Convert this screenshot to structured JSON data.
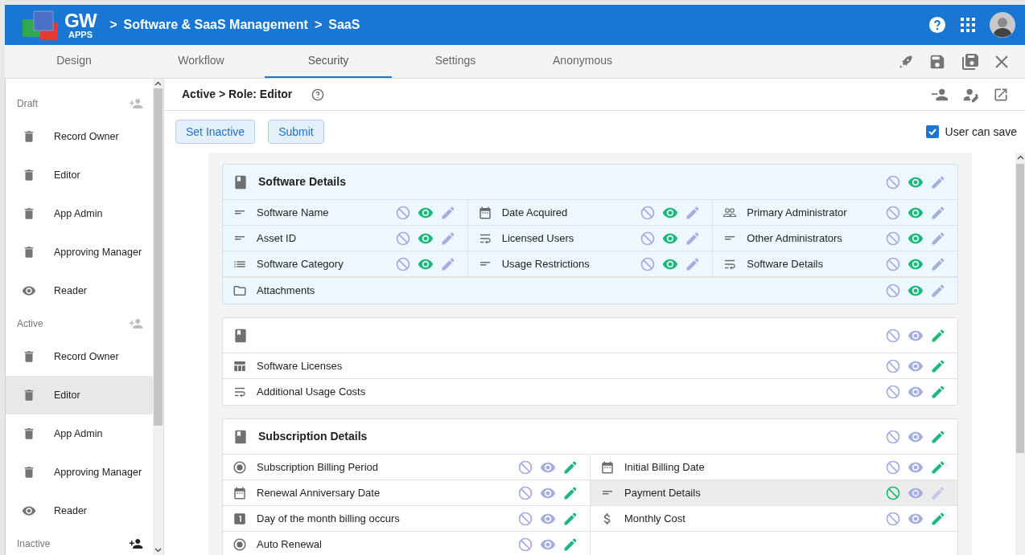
{
  "header": {
    "logo": {
      "word": "GW",
      "sub": "APPS"
    },
    "breadcrumb": [
      {
        "sep": ">",
        "label": "Software & SaaS Management"
      },
      {
        "sep": ">",
        "label": "SaaS"
      }
    ]
  },
  "tabs": [
    {
      "label": "Design",
      "selected": false
    },
    {
      "label": "Workflow",
      "selected": false
    },
    {
      "label": "Security",
      "selected": true
    },
    {
      "label": "Settings",
      "selected": false
    },
    {
      "label": "Anonymous",
      "selected": false
    }
  ],
  "sidebar": {
    "groups": [
      {
        "label": "Draft",
        "add_enabled": false,
        "items": [
          {
            "label": "Record Owner",
            "kind": "trash",
            "selected": false
          },
          {
            "label": "Editor",
            "kind": "trash",
            "selected": false
          },
          {
            "label": "App Admin",
            "kind": "trash",
            "selected": false
          },
          {
            "label": "Approving Manager",
            "kind": "trash",
            "selected": false
          },
          {
            "label": "Reader",
            "kind": "eye",
            "selected": false
          }
        ]
      },
      {
        "label": "Active",
        "add_enabled": false,
        "items": [
          {
            "label": "Record Owner",
            "kind": "trash",
            "selected": false
          },
          {
            "label": "Editor",
            "kind": "trash",
            "selected": true
          },
          {
            "label": "App Admin",
            "kind": "trash",
            "selected": false
          },
          {
            "label": "Approving Manager",
            "kind": "trash",
            "selected": false
          },
          {
            "label": "Reader",
            "kind": "eye",
            "selected": false
          }
        ]
      },
      {
        "label": "Inactive",
        "add_enabled": true
      }
    ]
  },
  "role_title": "Active > Role: Editor",
  "buttons": [
    "Set Inactive",
    "Submit"
  ],
  "user_can_save": {
    "label": "User can save",
    "checked": true
  },
  "sections": [
    {
      "title": "Software Details",
      "highlighted": true,
      "hidden": false,
      "readable": true,
      "editable": false,
      "columns": [
        [
          {
            "label": "Software Name",
            "kind": "text",
            "hidden": false,
            "readable": true,
            "editable": false,
            "selected": false
          },
          {
            "label": "Asset ID",
            "kind": "text",
            "hidden": false,
            "readable": true,
            "editable": false,
            "selected": false
          },
          {
            "label": "Software Category",
            "kind": "list",
            "hidden": false,
            "readable": true,
            "editable": false,
            "selected": false
          }
        ],
        [
          {
            "label": "Date Acquired",
            "kind": "date",
            "hidden": false,
            "readable": true,
            "editable": false,
            "selected": false
          },
          {
            "label": "Licensed Users",
            "kind": "multiline",
            "hidden": false,
            "readable": true,
            "editable": false,
            "selected": false
          },
          {
            "label": "Usage Restrictions",
            "kind": "text",
            "hidden": false,
            "readable": true,
            "editable": false,
            "selected": false
          }
        ],
        [
          {
            "label": "Primary Administrator",
            "kind": "people",
            "hidden": false,
            "readable": true,
            "editable": false,
            "selected": false
          },
          {
            "label": "Other Administrators",
            "kind": "text",
            "hidden": false,
            "readable": true,
            "editable": false,
            "selected": false
          },
          {
            "label": "Software Details",
            "kind": "multiline",
            "hidden": false,
            "readable": true,
            "editable": false,
            "selected": false
          }
        ]
      ],
      "rows": [
        {
          "label": "Attachments",
          "kind": "folder",
          "hidden": false,
          "readable": true,
          "editable": false,
          "selected": false
        }
      ]
    },
    {
      "highlighted": false,
      "hidden": false,
      "readable": false,
      "editable": true,
      "rows": [
        {
          "label": "Software Licenses",
          "kind": "table",
          "hidden": false,
          "readable": false,
          "editable": true,
          "selected": false
        },
        {
          "label": "Additional Usage Costs",
          "kind": "multiline",
          "hidden": false,
          "readable": false,
          "editable": true,
          "selected": false
        }
      ]
    },
    {
      "title": "Subscription Details",
      "highlighted": false,
      "hidden": false,
      "readable": false,
      "editable": true,
      "columns": [
        [
          {
            "label": "Subscription Billing Period",
            "kind": "radio",
            "hidden": false,
            "readable": false,
            "editable": true,
            "selected": false
          },
          {
            "label": "Renewal Anniversary Date",
            "kind": "date",
            "hidden": false,
            "readable": false,
            "editable": true,
            "selected": false
          },
          {
            "label": "Day of the month billing occurs",
            "kind": "number",
            "hidden": false,
            "readable": false,
            "editable": true,
            "selected": false
          },
          {
            "label": "Auto Renewal",
            "kind": "radio",
            "hidden": false,
            "readable": false,
            "editable": true,
            "selected": false
          }
        ],
        [
          {
            "label": "Initial Billing Date",
            "kind": "date",
            "hidden": false,
            "readable": false,
            "editable": true,
            "selected": false
          },
          {
            "label": "Payment Details",
            "kind": "text",
            "hidden": true,
            "readable": false,
            "editable": false,
            "selected": true
          },
          {
            "label": "Monthly Cost",
            "kind": "currency",
            "hidden": false,
            "readable": false,
            "editable": true,
            "selected": false
          }
        ]
      ]
    }
  ]
}
